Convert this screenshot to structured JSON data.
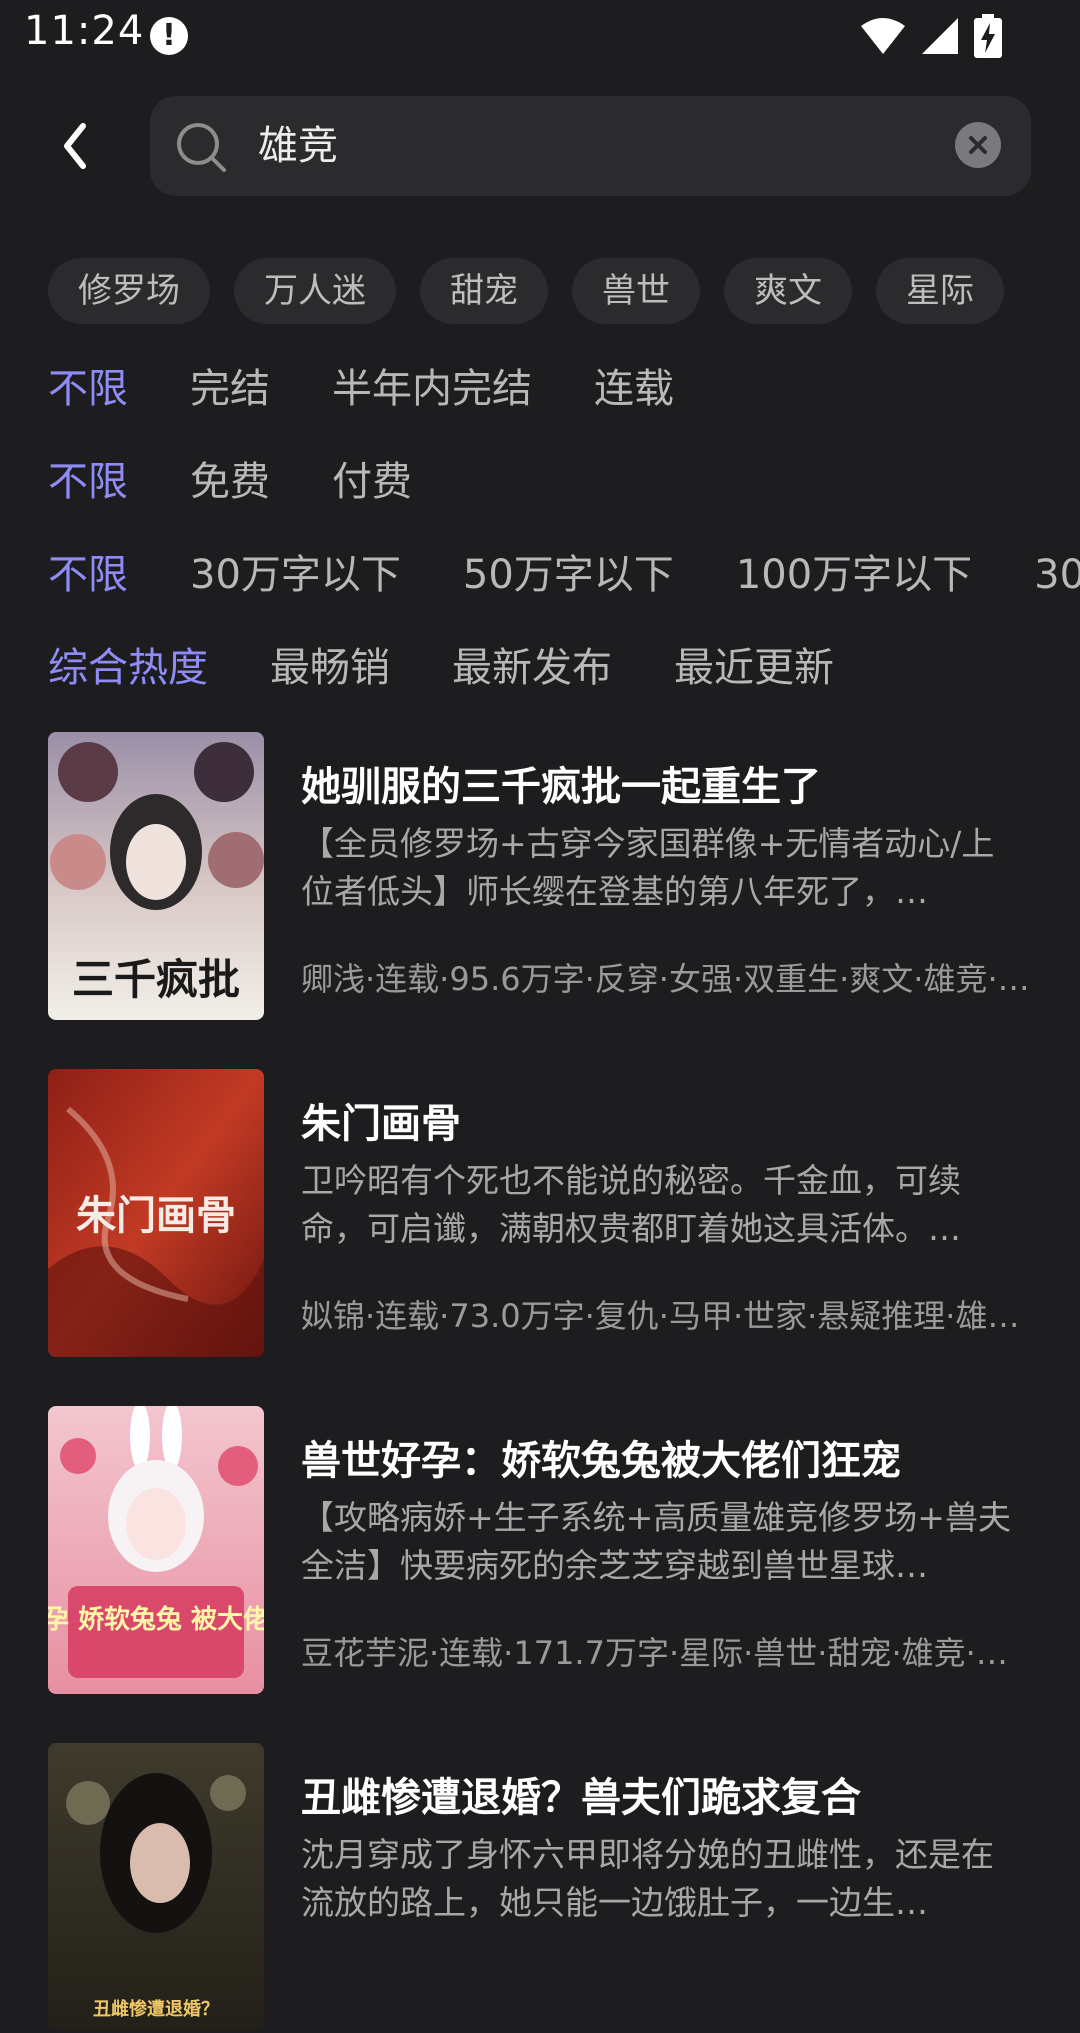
{
  "status_bar": {
    "time": "11:24",
    "alert_icon": "exclamation-icon",
    "icons": [
      "wifi-icon",
      "signal-icon",
      "battery-charging-icon"
    ]
  },
  "search": {
    "query": "雄竞",
    "back_icon": "chevron-left-icon",
    "search_icon": "search-icon",
    "clear_icon": "clear-icon"
  },
  "tags": [
    "修罗场",
    "万人迷",
    "甜宠",
    "兽世",
    "爽文",
    "星际"
  ],
  "filters": {
    "status": [
      "不限",
      "完结",
      "半年内完结",
      "连载"
    ],
    "price": [
      "不限",
      "免费",
      "付费"
    ],
    "words": [
      "不限",
      "30万字以下",
      "50万字以下",
      "100万字以下",
      "30"
    ],
    "sort": [
      "综合热度",
      "最畅销",
      "最新发布",
      "最近更新"
    ]
  },
  "colors": {
    "background": "#1d1d1f",
    "accent": "#8f8cf6",
    "chip": "#2b2b2e"
  },
  "books": [
    {
      "title": "她驯服的三千疯批一起重生了",
      "desc": "【全员修罗场+古穿今家国群像+无情者动心/上位者低头】师长缨在登基的第八年死了，…",
      "meta": "卿浅·连载·95.6万字·反穿·女强·双重生·爽文·雄竞·…",
      "cover_text": "三千疯批"
    },
    {
      "title": "朱门画骨",
      "desc": "卫吟昭有个死也不能说的秘密。千金血，可续命，可启谶，满朝权贵都盯着她这具活体。…",
      "meta": "姒锦·连载·73.0万字·复仇·马甲·世家·悬疑推理·雄…",
      "cover_text": "朱门画骨"
    },
    {
      "title": "兽世好孕：娇软兔兔被大佬们狂宠",
      "desc": "【攻略病娇+生子系统+高质量雄竞修罗场+兽夫全洁】快要病死的余芝芝穿越到兽世星球…",
      "meta": "豆花芋泥·连载·171.7万字·星际·兽世·甜宠·雄竞·…",
      "cover_text": "兽世好孕 娇软兔兔 被大佬们狂宠"
    },
    {
      "title": "丑雌惨遭退婚？兽夫们跪求复合",
      "desc": "沈月穿成了身怀六甲即将分娩的丑雌性，还是在流放的路上，她只能一边饿肚子，一边生…",
      "meta": "",
      "cover_text": "丑雌惨遭退婚？"
    }
  ]
}
